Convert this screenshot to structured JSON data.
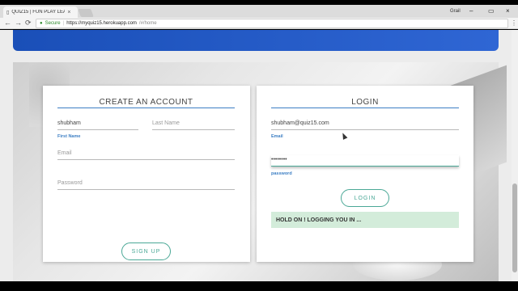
{
  "browser": {
    "tab_title": "QUIZ15 | FUN PLAY LEA",
    "tab_close": "×",
    "profile_name": "Grail",
    "url_secure_label": "Secure",
    "url_host": "https://myquiz15.herokuapp.com",
    "url_path": "/#/home",
    "icons": {
      "back": "←",
      "forward": "→",
      "reload": "⟳",
      "lock": "🔒",
      "menu": "⋮",
      "minimize": "–",
      "restore": "▭",
      "close": "×"
    }
  },
  "create_account": {
    "title": "CREATE AN ACCOUNT",
    "first_name_value": "shubham",
    "first_name_label": "First Name",
    "last_name_placeholder": "Last Name",
    "email_placeholder": "Email",
    "password_placeholder": "Password",
    "signup_label": "SIGN UP"
  },
  "login": {
    "title": "LOGIN",
    "email_value": "shubham@quiz15.com",
    "email_label": "Email",
    "password_value": "••••••••",
    "password_label": "password",
    "login_label": "LOGIN",
    "status_message": "HOLD ON ! LOGGING YOU IN ..."
  },
  "colors": {
    "accent_blue": "#3d7fc4",
    "accent_teal": "#4aa896",
    "hero_blue": "#1a4fb8",
    "status_bg": "#d3ecda"
  }
}
